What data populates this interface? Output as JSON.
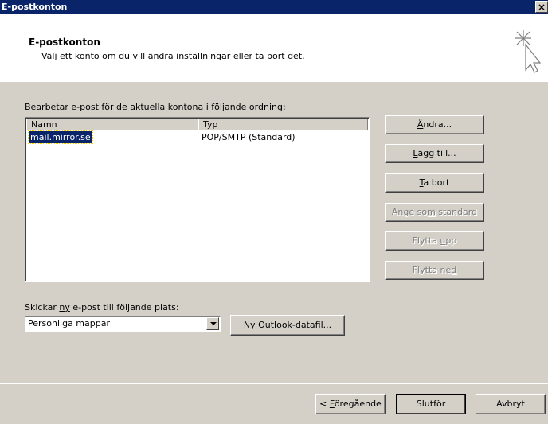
{
  "window": {
    "title": "E-postkonton",
    "close_glyph": "×"
  },
  "header": {
    "title": "E-postkonton",
    "subtitle": "Välj ett konto om du vill ändra inställningar eller ta bort det.",
    "icon": "wizard-cursor-icon"
  },
  "accounts": {
    "label": "Bearbetar e-post för de aktuella kontona i följande ordning:",
    "columns": [
      "Namn",
      "Typ"
    ],
    "rows": [
      {
        "name": "mail.mirror.se",
        "type": "POP/SMTP (Standard)"
      }
    ]
  },
  "side_buttons": {
    "change": {
      "pre": "",
      "key": "Ä",
      "post": "ndra..."
    },
    "add": {
      "pre": "",
      "key": "L",
      "post": "ägg till..."
    },
    "remove": {
      "pre": "",
      "key": "T",
      "post": "a bort"
    },
    "set_default": {
      "pre": "Ange so",
      "key": "m",
      "post": " standard"
    },
    "move_up": {
      "pre": "Flytta ",
      "key": "u",
      "post": "pp"
    },
    "move_down": {
      "pre": "Flytta ne",
      "key": "d",
      "post": ""
    }
  },
  "delivery": {
    "label_pre": "Skickar ",
    "label_key": "ny",
    "label_post": " e-post till följande plats:",
    "selected": "Personliga mappar",
    "new_datafile": {
      "pre": "Ny ",
      "key": "O",
      "post": "utlook-datafil..."
    }
  },
  "footer": {
    "back": {
      "pre": "< ",
      "key": "F",
      "post": "öregående"
    },
    "finish": "Slutför",
    "cancel": "Avbryt"
  }
}
